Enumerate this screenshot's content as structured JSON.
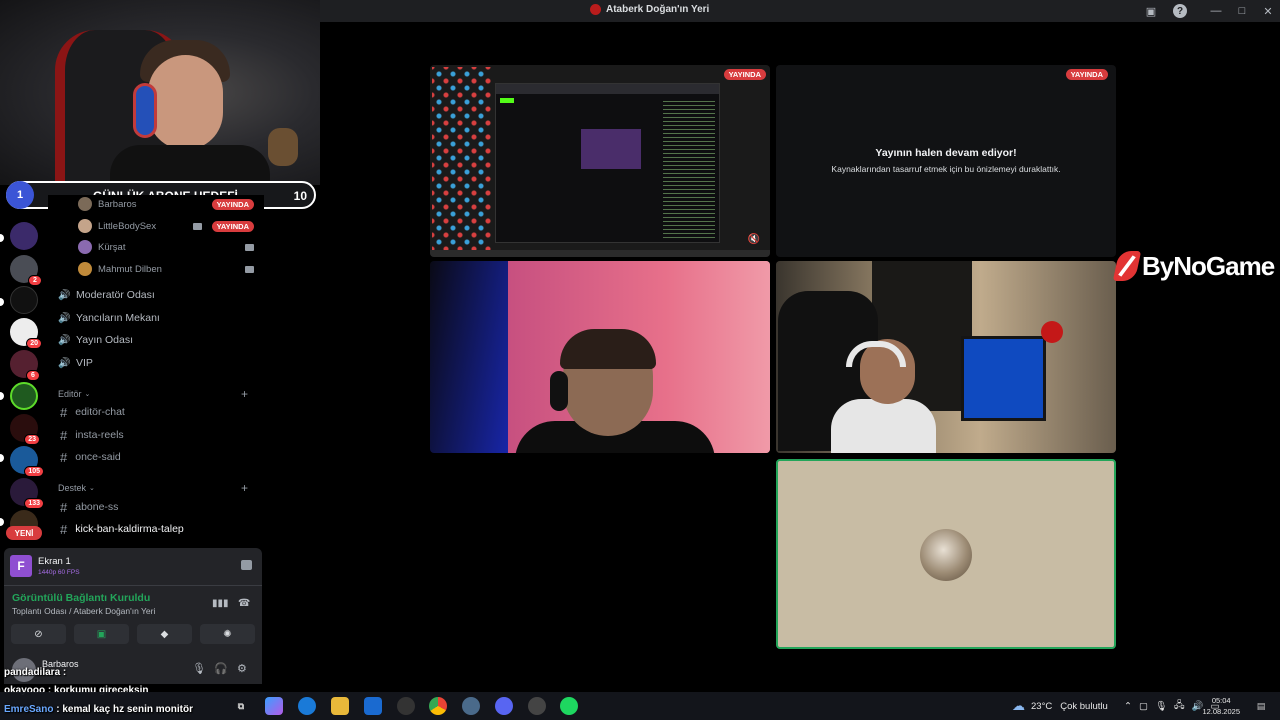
{
  "window": {
    "title": "Ataberk Doğan'ın Yeri"
  },
  "goal": {
    "current": "1",
    "title": "GÜNLÜK ABONE HEDEFİ",
    "target": "10"
  },
  "rail": {
    "badges": [
      "2",
      "20",
      "6",
      "23",
      "105",
      "133"
    ],
    "new_label": "YENİ"
  },
  "voice_members": [
    {
      "name": "Barbaros",
      "live": "YAYINDA"
    },
    {
      "name": "LittleBodySex",
      "live": "YAYINDA"
    },
    {
      "name": "Kürşat"
    },
    {
      "name": "Mahmut Dilben"
    }
  ],
  "voice_channels": [
    "Moderatör Odası",
    "Yancıların Mekanı",
    "Yayın Odası",
    "VIP"
  ],
  "categories": {
    "editor": "Editör",
    "destek": "Destek"
  },
  "text_channels": {
    "editor": [
      "editör-chat",
      "insta-reels",
      "once-said"
    ],
    "destek": [
      "abone-ss",
      "kick-ban-kaldirma-talep"
    ]
  },
  "voice_panel": {
    "screen_name": "Ekran 1",
    "screen_quality": "1440p 60 FPS",
    "status": "Görüntülü Bağlantı Kuruldu",
    "room": "Toplantı Odası / Ataberk Doğan'ın Yeri"
  },
  "user_panel": {
    "username": "Barbaros"
  },
  "tiles": {
    "live_label": "YAYINDA",
    "paused_title": "Yayının halen devam ediyor!",
    "paused_subtitle": "Kaynaklarından tasarruf etmek için bu önizlemeyi duraklattık."
  },
  "brand": {
    "name": "ByNoGame"
  },
  "chat": [
    {
      "user": "pandadilara",
      "message": ""
    },
    {
      "user": "okayooo",
      "message": "korkumu gireceksin"
    },
    {
      "user": "EmreSano",
      "message": "kemal kaç hz senin monitör"
    }
  ],
  "taskbar": {
    "weather": "23°C",
    "weather_desc": "Çok bulutlu",
    "time": "05:04",
    "date": "12.08.2025"
  },
  "colors": {
    "accent_live": "#d83c3e",
    "connected": "#23a55a",
    "brand": "#e23434"
  }
}
